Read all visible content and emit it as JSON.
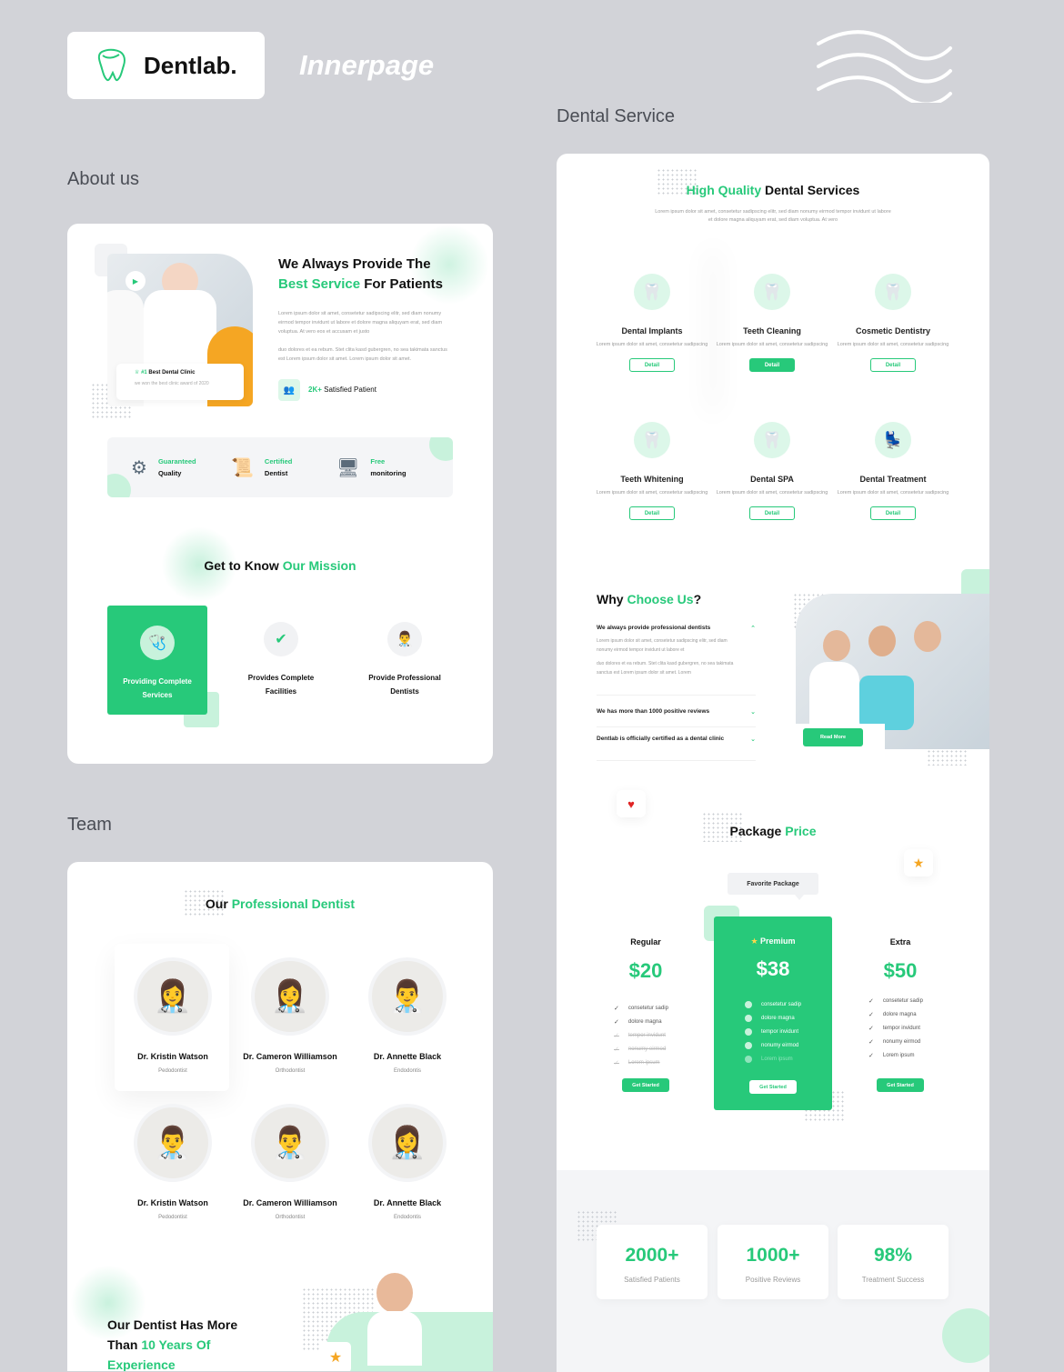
{
  "brand": {
    "name": "Dentlab.",
    "subtitle": "Innerpage"
  },
  "colors": {
    "accent": "#27c97a",
    "background": "#d2d3d8",
    "accent_light": "#dcf7e9"
  },
  "sections": {
    "about": "About us",
    "team": "Team",
    "dental_service": "Dental Service"
  },
  "about": {
    "title_line1": "We Always Provide The",
    "title_green": "Best Service",
    "title_line2_rest": " For Patients",
    "paragraph1": "Lorem ipsum dolor sit amet, consetetur sadipscing elitr, sed diam nonumy eirmod tempor invidunt ut labore et dolore magna aliquyam erat, sed diam voluptua. At vero eos et accusam et justo",
    "paragraph2": "duo dolores et ea rebum. Stet clita kasd gubergren, no sea takimata sanctus est Lorem ipsum dolor sit amet. Lorem ipsum dolor sit amet.",
    "badge_prefix": "#1",
    "badge_title": "Best Dental Clinic",
    "badge_sub": "we won the best clinic award of 2020",
    "patients_count": "2K+",
    "patients_label": "Satisfied Patient",
    "features": [
      {
        "top": "Guaranteed",
        "bottom": "Quality",
        "icon": "thumbs-up-badge-icon"
      },
      {
        "top": "Certified",
        "bottom": "Dentist",
        "icon": "certificate-icon"
      },
      {
        "top": "Free",
        "bottom": "monitoring",
        "icon": "monitoring-icon"
      }
    ],
    "mission_title": "Get to Know",
    "mission_green": "Our Mission",
    "missions": [
      {
        "label": "Providing Complete Services",
        "active": true
      },
      {
        "label": "Provides Complete Facilities",
        "active": false
      },
      {
        "label": "Provide Professional Dentists",
        "active": false
      }
    ]
  },
  "team": {
    "title": "Our",
    "title_green": "Professional Dentist",
    "doctors": [
      {
        "name": "Dr. Kristin Watson",
        "role": "Pedodontist"
      },
      {
        "name": "Dr. Cameron Williamson",
        "role": "Orthodontist"
      },
      {
        "name": "Dr. Annette Black",
        "role": "Endodontis"
      },
      {
        "name": "Dr. Kristin Watson",
        "role": "Pedodontist"
      },
      {
        "name": "Dr. Cameron Williamson",
        "role": "Orthodontist"
      },
      {
        "name": "Dr. Annette Black",
        "role": "Endodontis"
      }
    ],
    "experience_line1": "Our Dentist Has More",
    "experience_line2": "Than",
    "experience_green": "10 Years Of",
    "experience_line3": "Experience"
  },
  "services": {
    "title_green": "High Quality",
    "title": "Dental Services",
    "description": "Lorem ipsum dolor sit amet, consetetur sadipscing elitr, sed diam nonumy eirmod tempor invidunt ut labore et dolore magna aliquyam erat, sed diam voluptua. At vero",
    "items": [
      {
        "title": "Dental Implants",
        "desc": "Lorem ipsum dolor sit amet, consetetur sadipscing",
        "button": "Detail",
        "active": false
      },
      {
        "title": "Teeth Cleaning",
        "desc": "Lorem ipsum dolor sit amet, consetetur sadipscing",
        "button": "Detail",
        "active": true
      },
      {
        "title": "Cosmetic Dentistry",
        "desc": "Lorem ipsum dolor sit amet, consetetur sadipscing",
        "button": "Detail",
        "active": false
      },
      {
        "title": "Teeth Whitening",
        "desc": "Lorem ipsum dolor sit amet, consetetur sadipscing",
        "button": "Detail",
        "active": false
      },
      {
        "title": "Dental SPA",
        "desc": "Lorem ipsum dolor sit amet, consetetur sadipscing",
        "button": "Detail",
        "active": false
      },
      {
        "title": "Dental Treatment",
        "desc": "Lorem ipsum dolor sit amet, consetetur sadipscing",
        "button": "Detail",
        "active": false
      }
    ]
  },
  "why": {
    "title": "Why",
    "title_green": "Choose Us",
    "title_end": "?",
    "faq": [
      {
        "q": "We always provide professional dentists",
        "open": true,
        "a1": "Lorem ipsum dolor sit amet, consetetur sadipscing elitr, sed diam nonumy eirmod tempor invidunt ut labore et",
        "a2": "duo dolores et ea rebum. Stet clita kasd gubergren, no sea takimata sanctus est Lorem ipsum dolor sit amet. Lorem"
      },
      {
        "q": "We has more than 1000 positive reviews",
        "open": false
      },
      {
        "q": "Dentlab is officially certified as a dental clinic",
        "open": false
      }
    ],
    "read_more": "Read More"
  },
  "pricing": {
    "title": "Package",
    "title_green": "Price",
    "favorite_tag": "Favorite Package",
    "plans": [
      {
        "name": "Regular",
        "price": "$20",
        "features": [
          {
            "text": "consetetur sadip",
            "on": true
          },
          {
            "text": "dolore magna",
            "on": true
          },
          {
            "text": "tempor invidunt",
            "on": false
          },
          {
            "text": "nonumy eirmod",
            "on": false
          },
          {
            "text": "Lorem ipsum",
            "on": false
          }
        ],
        "button": "Get Started"
      },
      {
        "name": "Premium",
        "price": "$38",
        "features": [
          {
            "text": "consetetur sadip",
            "on": true
          },
          {
            "text": "dolore magna",
            "on": true
          },
          {
            "text": "tempor invidunt",
            "on": true
          },
          {
            "text": "nonumy eirmod",
            "on": true
          },
          {
            "text": "Lorem ipsum",
            "on": false
          }
        ],
        "button": "Get Started"
      },
      {
        "name": "Extra",
        "price": "$50",
        "features": [
          {
            "text": "consetetur sadip",
            "on": true
          },
          {
            "text": "dolore magna",
            "on": true
          },
          {
            "text": "tempor invidunt",
            "on": true
          },
          {
            "text": "nonumy eirmod",
            "on": true
          },
          {
            "text": "Lorem ipsum",
            "on": true
          }
        ],
        "button": "Get Started"
      }
    ]
  },
  "stats": [
    {
      "value": "2000+",
      "label": "Satisfied Patients"
    },
    {
      "value": "1000+",
      "label": "Positive Reviews"
    },
    {
      "value": "98%",
      "label": "Treatment Success"
    }
  ]
}
